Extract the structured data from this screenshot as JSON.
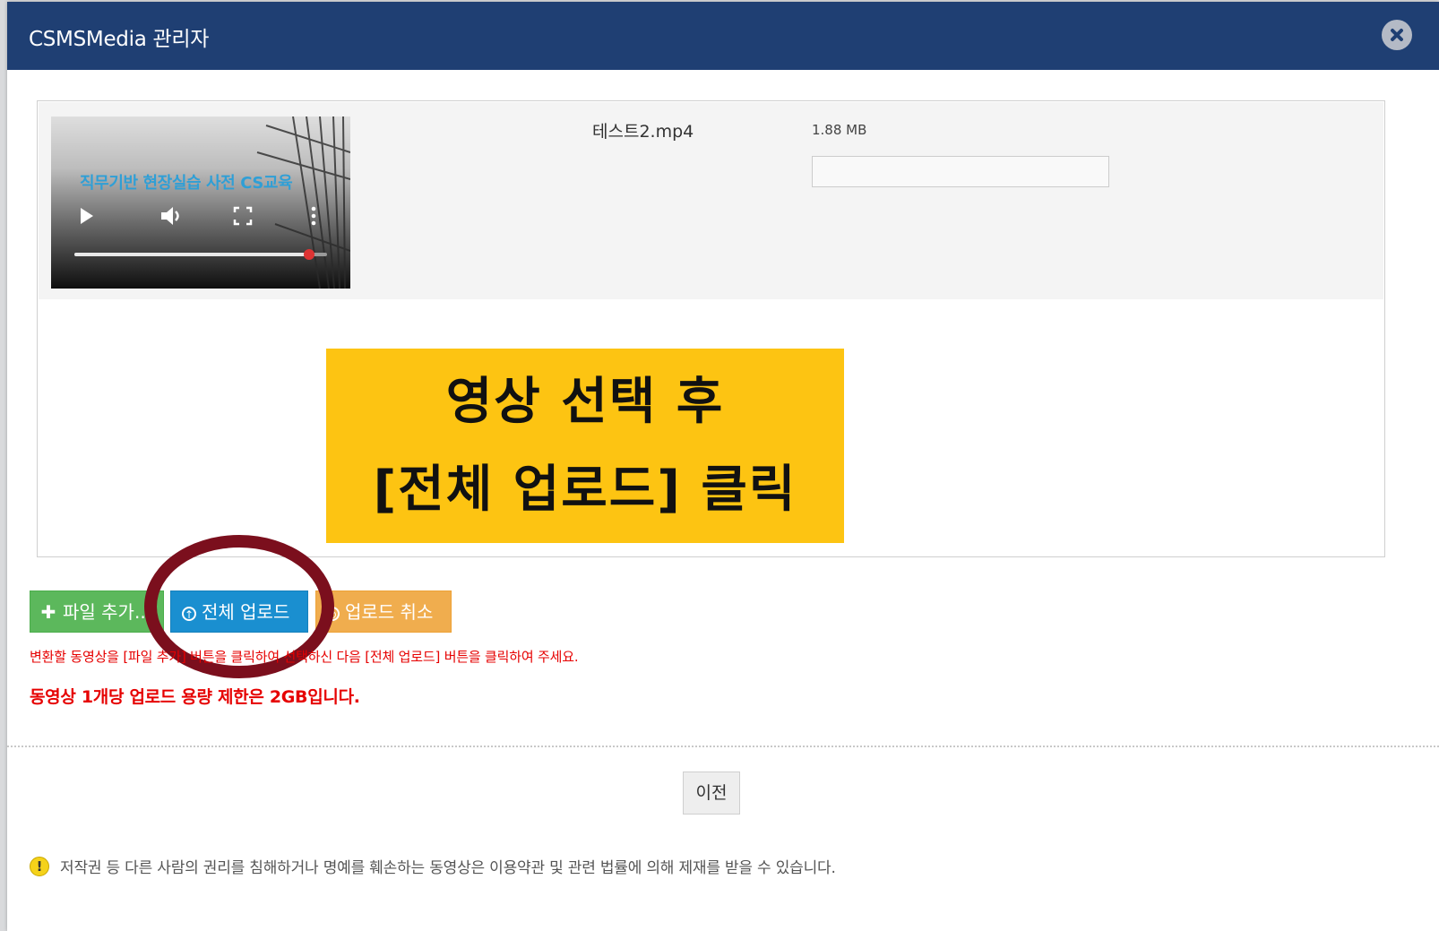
{
  "dialog": {
    "title": "CSMSMedia 관리자",
    "close_icon": "close-icon"
  },
  "file": {
    "name": "테스트2.mp4",
    "size": "1.88 MB",
    "upload_progress_fraction": 0,
    "video_caption": "직무기반 현장실습 사전 CS교육",
    "video_playback_fraction": 0.93
  },
  "callout": {
    "line1": "영상 선택 후",
    "line2": "[전체 업로드] 클릭"
  },
  "buttons": {
    "add_label": "파일 추가..",
    "upload_all_label": "전체 업로드",
    "cancel_label": "업로드 취소",
    "prev_label": "이전"
  },
  "messages": {
    "help": "변환할 동영상을 [파일 추가] 버튼을 클릭하여 선택하신 다음 [전체 업로드] 버튼을 클릭하여 주세요.",
    "limit": "동영상 1개당 업로드 용량 제한은 2GB입니다.",
    "notice": "저작권 등 다른 사람의 권리를 침해하거나 명예를 훼손하는 동영상은 이용약관 및 관련 법률에 의해 제재를 받을 수 있습니다."
  },
  "colors": {
    "titlebar": "#1f3f73",
    "add_button": "#5cb85c",
    "upload_button": "#1a8fd0",
    "cancel_button": "#f0ad4e",
    "callout": "#fdc412",
    "highlight_ring": "#7b0f1d",
    "error_text": "#e60000"
  }
}
